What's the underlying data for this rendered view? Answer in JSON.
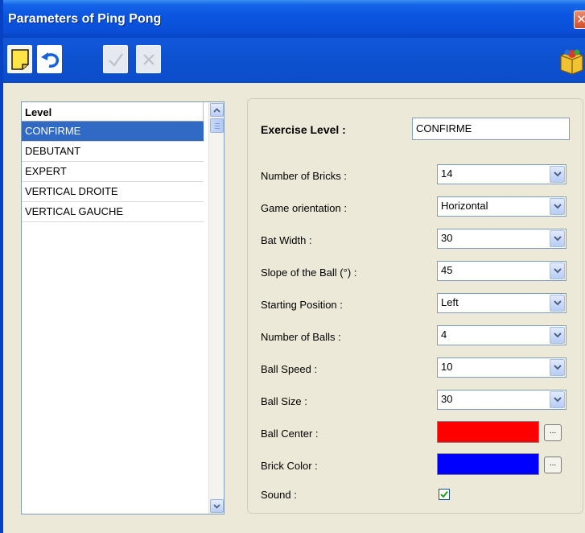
{
  "window": {
    "title": "Parameters of Ping Pong",
    "close_glyph": "✕"
  },
  "toolbar": {
    "buttons": [
      {
        "name": "new",
        "icon": "new-note-icon",
        "enabled": true
      },
      {
        "name": "undo",
        "icon": "undo-icon",
        "enabled": true
      },
      {
        "name": "confirm",
        "icon": "checkmark-icon",
        "enabled": false
      },
      {
        "name": "cancel",
        "icon": "cross-icon",
        "enabled": false
      },
      {
        "name": "package",
        "icon": "package-box-icon",
        "enabled": true
      }
    ]
  },
  "levels": {
    "header": "Level",
    "items": [
      "CONFIRME",
      "DEBUTANT",
      "EXPERT",
      "VERTICAL DROITE",
      "VERTICAL GAUCHE"
    ],
    "selected": "CONFIRME"
  },
  "params": {
    "exercise_level_label": "Exercise Level :",
    "exercise_level_value": "CONFIRME",
    "fields": [
      {
        "label": "Number of Bricks :",
        "value": "14"
      },
      {
        "label": "Game orientation :",
        "value": "Horizontal"
      },
      {
        "label": "Bat Width :",
        "value": "30"
      },
      {
        "label": "Slope of the Ball (°) :",
        "value": "45"
      },
      {
        "label": "Starting Position :",
        "value": "Left"
      },
      {
        "label": "Number of Balls :",
        "value": "4"
      },
      {
        "label": "Ball Speed :",
        "value": "10"
      },
      {
        "label": "Ball Size :",
        "value": "30"
      }
    ],
    "ball_center": {
      "label": "Ball Center :",
      "color": "#ff0000",
      "button": "..."
    },
    "brick_color": {
      "label": "Brick Color :",
      "color": "#0000ff",
      "button": "..."
    },
    "sound": {
      "label": "Sound :",
      "checked": true
    }
  },
  "colors": {
    "titlebar": "#0b55e0",
    "selection": "#316ac5"
  }
}
